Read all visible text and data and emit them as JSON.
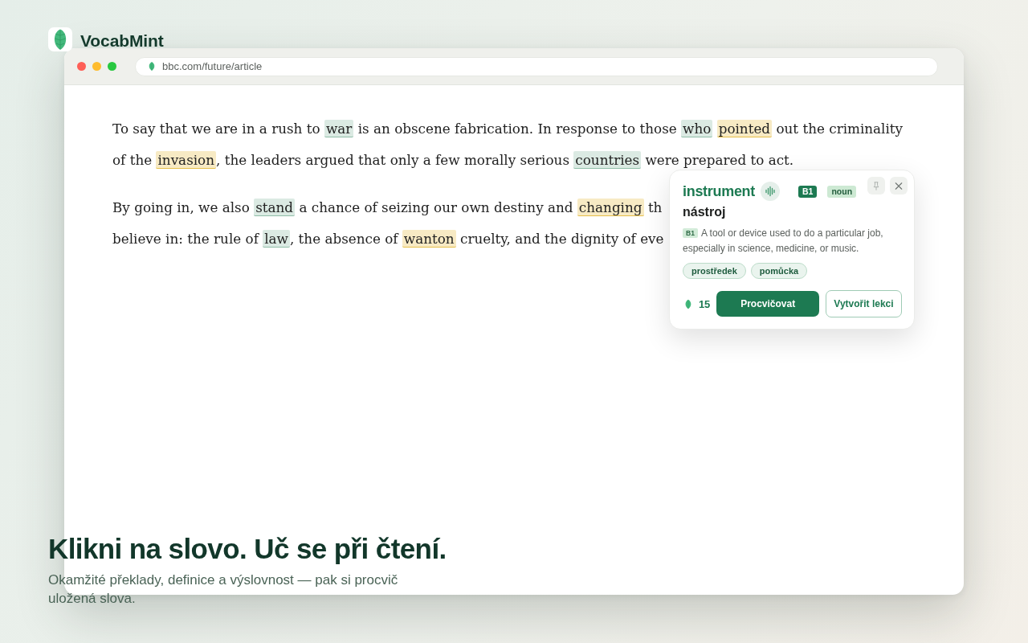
{
  "app": {
    "name": "VocabMint"
  },
  "browser": {
    "url": "bbc.com/future/article"
  },
  "article": {
    "paragraphs": [
      {
        "lines": [
          [
            {
              "text": "To say that we are in a rush to "
            },
            {
              "text": "war",
              "color": "#dbeae3"
            },
            {
              "text": " is an obscene fabrication. In response to those "
            },
            {
              "text": "who",
              "color": "#dbeae3"
            },
            {
              "text": "pointed",
              "color": "#f7eac4"
            },
            {
              "text": " out the criminality"
            }
          ],
          [
            {
              "text": "of the "
            },
            {
              "text": "invasion",
              "color": "#f7eac4"
            },
            {
              "text": ", the leaders argued that only a few morally serious "
            },
            {
              "text": "countries",
              "color": "#dbeae3"
            },
            {
              "text": " were prepared to act."
            }
          ]
        ]
      },
      {
        "lines": [
          [
            {
              "text": "By going in, we also "
            },
            {
              "text": "stand",
              "color": "#dbeae3"
            },
            {
              "text": " a chance of seizing our own destiny and "
            },
            {
              "text": "changing",
              "color": "#f7eac4"
            },
            {
              "text": " th"
            }
          ],
          [
            {
              "text": "believe in: the rule of "
            },
            {
              "text": "law",
              "color": "#dbeae3"
            },
            {
              "text": ", the absence of "
            },
            {
              "text": "wanton",
              "color": "#f7eac4"
            },
            {
              "text": " cruelty, and the dignity of eve"
            }
          ]
        ]
      }
    ]
  },
  "popup": {
    "word": "instrument",
    "cefr": "B1",
    "part_of_speech": "noun",
    "translation": "nástroj",
    "definition": {
      "cefr": "B1",
      "text": "A tool or device used to do a particular job, especially in science, medicine, or music."
    },
    "synonyms": [
      "prostředek",
      "pomůcka"
    ],
    "count": "15",
    "buttons": [
      {
        "label": "Procvičovat",
        "kind": "primary"
      },
      {
        "label": "Vytvořit lekci",
        "kind": "secondary"
      }
    ]
  },
  "hero": {
    "title": "Klikni na slovo. Uč se při čtení.",
    "subtitle": "Okamžité překlady, definice a výslovnost — pak si procvič uložená slova."
  }
}
